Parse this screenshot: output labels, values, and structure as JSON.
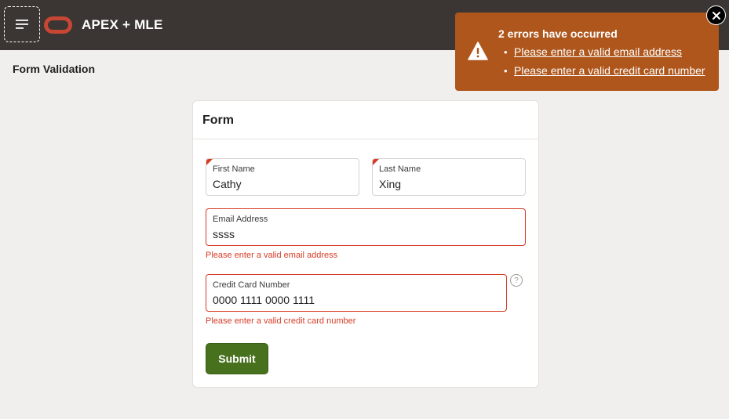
{
  "header": {
    "app_title": "APEX + MLE",
    "menu_icon": "hamburger-menu-icon",
    "logo_icon": "oracle-logo-icon"
  },
  "page": {
    "title": "Form Validation"
  },
  "form": {
    "title": "Form",
    "first_name": {
      "label": "First Name",
      "value": "Cathy",
      "required": true
    },
    "last_name": {
      "label": "Last Name",
      "value": "Xing",
      "required": true
    },
    "email": {
      "label": "Email Address",
      "value": "ssss",
      "error": "Please enter a valid email address"
    },
    "credit_card": {
      "label": "Credit Card Number",
      "value": "0000 1111 0000 1111",
      "error": "Please enter a valid credit card number",
      "help_icon": "?"
    },
    "submit_label": "Submit"
  },
  "alert": {
    "title": "2 errors have occurred",
    "icon": "warning-icon",
    "errors": [
      "Please enter a valid email address",
      "Please enter a valid credit card number"
    ]
  },
  "colors": {
    "header_bg": "#3b3633",
    "accent_error": "#d63b25",
    "alert_bg": "#ae561b",
    "submit_bg": "#48711d"
  }
}
